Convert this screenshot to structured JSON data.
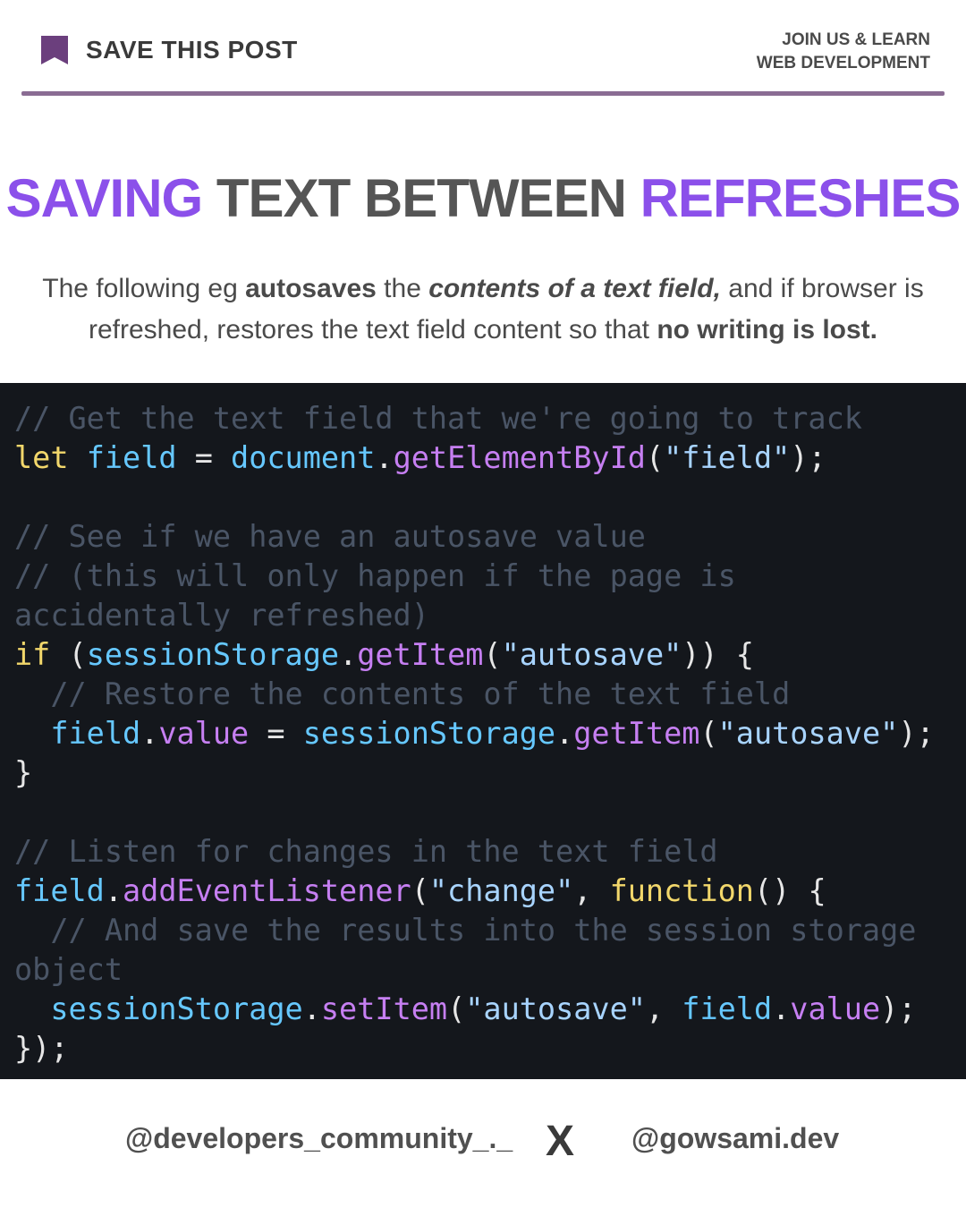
{
  "header": {
    "save_label": "SAVE THIS POST",
    "join_line1": "JOIN US & LEARN",
    "join_line2": "WEB DEVELOPMENT",
    "bookmark_icon": "bookmark-icon",
    "accent_color": "#8a6c93"
  },
  "title": {
    "word1": "SAVING",
    "middle": " TEXT BETWEEN ",
    "word2": "REFRESHES",
    "accent_color": "#8b50ea"
  },
  "description": {
    "p1": "The following eg ",
    "b1": "autosaves",
    "p2": " the ",
    "bi1": "contents of a text field,",
    "p3": " and if browser is refreshed, restores the text field content so that ",
    "b2": "no writing is lost."
  },
  "code": {
    "lines": [
      [
        {
          "t": "// Get the text field that we're going to track",
          "c": "com"
        }
      ],
      [
        {
          "t": "let",
          "c": "kw"
        },
        {
          "t": " ",
          "c": "plain"
        },
        {
          "t": "field",
          "c": "var"
        },
        {
          "t": " = ",
          "c": "plain"
        },
        {
          "t": "document",
          "c": "var"
        },
        {
          "t": ".",
          "c": "plain"
        },
        {
          "t": "getElementById",
          "c": "fn"
        },
        {
          "t": "(",
          "c": "plain"
        },
        {
          "t": "\"field\"",
          "c": "str"
        },
        {
          "t": ");",
          "c": "plain"
        }
      ],
      [],
      [
        {
          "t": "// See if we have an autosave value",
          "c": "com"
        }
      ],
      [
        {
          "t": "// (this will only happen if the page is",
          "c": "com"
        }
      ],
      [
        {
          "t": "accidentally refreshed)",
          "c": "com"
        }
      ],
      [
        {
          "t": "if",
          "c": "kw"
        },
        {
          "t": " (",
          "c": "plain"
        },
        {
          "t": "sessionStorage",
          "c": "var"
        },
        {
          "t": ".",
          "c": "plain"
        },
        {
          "t": "getItem",
          "c": "fn"
        },
        {
          "t": "(",
          "c": "plain"
        },
        {
          "t": "\"autosave\"",
          "c": "str"
        },
        {
          "t": ")) {",
          "c": "plain"
        }
      ],
      [
        {
          "t": "  // Restore the contents of the text field",
          "c": "com"
        }
      ],
      [
        {
          "t": "  ",
          "c": "plain"
        },
        {
          "t": "field",
          "c": "var"
        },
        {
          "t": ".",
          "c": "plain"
        },
        {
          "t": "value",
          "c": "fn"
        },
        {
          "t": " = ",
          "c": "plain"
        },
        {
          "t": "sessionStorage",
          "c": "var"
        },
        {
          "t": ".",
          "c": "plain"
        },
        {
          "t": "getItem",
          "c": "fn"
        },
        {
          "t": "(",
          "c": "plain"
        },
        {
          "t": "\"autosave\"",
          "c": "str"
        },
        {
          "t": ");",
          "c": "plain"
        }
      ],
      [
        {
          "t": "}",
          "c": "plain"
        }
      ],
      [],
      [
        {
          "t": "// Listen for changes in the text field",
          "c": "com"
        }
      ],
      [
        {
          "t": "field",
          "c": "var"
        },
        {
          "t": ".",
          "c": "plain"
        },
        {
          "t": "addEventListener",
          "c": "fn"
        },
        {
          "t": "(",
          "c": "plain"
        },
        {
          "t": "\"change\"",
          "c": "str"
        },
        {
          "t": ", ",
          "c": "plain"
        },
        {
          "t": "function",
          "c": "kw"
        },
        {
          "t": "() {",
          "c": "plain"
        }
      ],
      [
        {
          "t": "  // And save the results into the session storage",
          "c": "com"
        }
      ],
      [
        {
          "t": "object",
          "c": "com"
        }
      ],
      [
        {
          "t": "  ",
          "c": "plain"
        },
        {
          "t": "sessionStorage",
          "c": "var"
        },
        {
          "t": ".",
          "c": "plain"
        },
        {
          "t": "setItem",
          "c": "fn"
        },
        {
          "t": "(",
          "c": "plain"
        },
        {
          "t": "\"autosave\"",
          "c": "str"
        },
        {
          "t": ", ",
          "c": "plain"
        },
        {
          "t": "field",
          "c": "var"
        },
        {
          "t": ".",
          "c": "plain"
        },
        {
          "t": "value",
          "c": "fn"
        },
        {
          "t": ");",
          "c": "plain"
        }
      ],
      [
        {
          "t": "});",
          "c": "plain"
        }
      ]
    ]
  },
  "footer": {
    "left_handle": "@developers_community_._",
    "separator": "X",
    "right_handle": "@gowsami.dev"
  }
}
